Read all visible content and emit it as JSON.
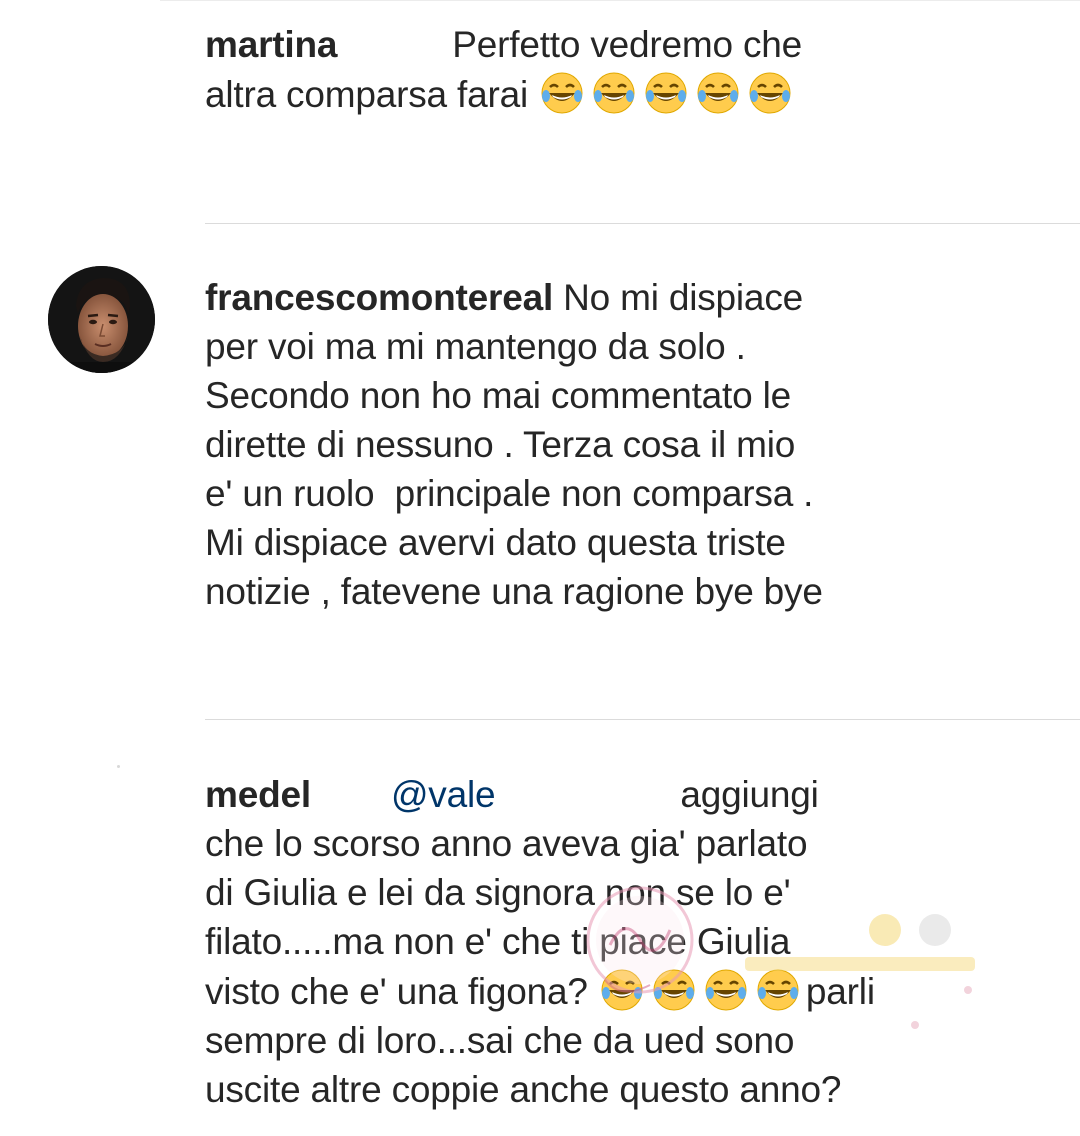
{
  "comments": [
    {
      "username": "martina",
      "text_lines": [
        "Perfetto vedremo che",
        "altra comparsa farai"
      ],
      "emoji_count": 5,
      "emoji_name": "laughing-tears"
    },
    {
      "username": "francescomontereal",
      "text_lines": [
        "No mi dispiace",
        "per voi ma mi mantengo da solo .",
        "Secondo non ho mai commentato le",
        "dirette di nessuno . Terza cosa il mio",
        "e' un ruolo  principale non comparsa .",
        "Mi dispiace avervi dato questa triste",
        "notizie , fatevene una ragione bye bye"
      ]
    },
    {
      "username": "medel",
      "mention": "@vale",
      "text_lines": [
        "aggiungi",
        "che lo scorso anno aveva gia' parlato",
        "di Giulia e lei da signora non se lo e'",
        "filato.....ma non e' che ti piace Giulia",
        "visto che e' una figona?",
        "parli",
        "sempre di loro...sai che da ued sono",
        "uscite altre coppie anche questo anno?"
      ],
      "emoji_count": 4,
      "emoji_name": "laughing-tears"
    }
  ],
  "colors": {
    "text": "#262626",
    "mention": "#003569",
    "divider": "#dbdbdb",
    "emoji_face": "#ffcc4d"
  }
}
